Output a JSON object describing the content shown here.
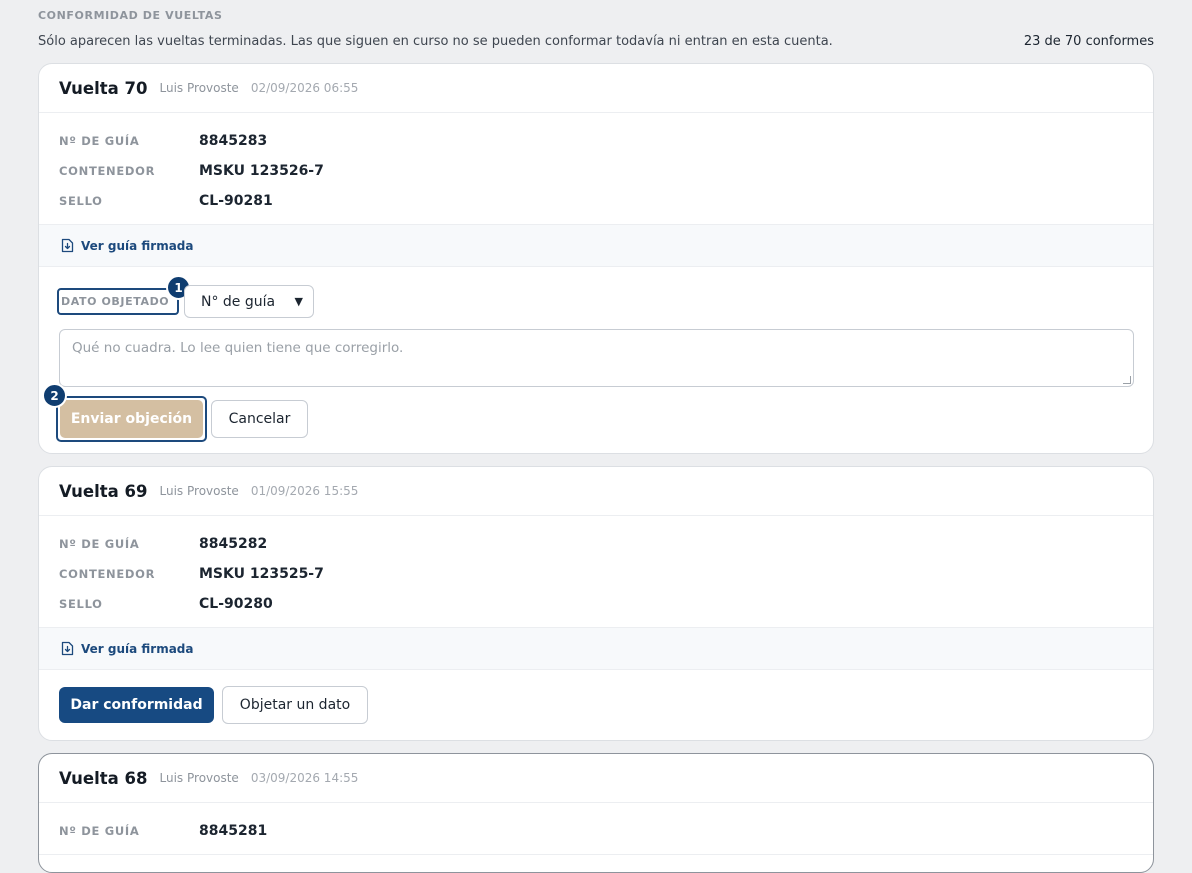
{
  "section_title": "CONFORMIDAD DE VUELTAS",
  "intro": "Sólo aparecen las vueltas terminadas. Las que siguen en curso no se pueden conformar todavía ni entran en esta cuenta.",
  "count": "23 de 70 conformes",
  "labels": {
    "guia": "Nº DE GUÍA",
    "contenedor": "CONTENEDOR",
    "sello": "SELLO"
  },
  "guide_link": "Ver guía firmada",
  "cards": [
    {
      "title": "Vuelta 70",
      "driver": "Luis Provoste",
      "date": "02/09/2026 06:55",
      "guia": "8845283",
      "contenedor": "MSKU 123526-7",
      "sello": "CL-90281"
    },
    {
      "title": "Vuelta 69",
      "driver": "Luis Provoste",
      "date": "01/09/2026 15:55",
      "guia": "8845282",
      "contenedor": "MSKU 123525-7",
      "sello": "CL-90280"
    },
    {
      "title": "Vuelta 68",
      "driver": "Luis Provoste",
      "date": "03/09/2026 14:55",
      "guia": "8845281"
    }
  ],
  "objection": {
    "field_label": "DATO OBJETADO",
    "select_value": "N° de guía",
    "placeholder": "Qué no cuadra. Lo lee quien tiene que corregirlo.",
    "send": "Enviar objeción",
    "cancel": "Cancelar"
  },
  "actions": {
    "confirm": "Dar conformidad",
    "object": "Objetar un dato"
  },
  "badges": [
    "1",
    "2"
  ],
  "colors": {
    "primary": "#174a82",
    "badge": "#0f3d70",
    "send_disabled": "#d4bfa2",
    "background": "#eeeff1"
  }
}
